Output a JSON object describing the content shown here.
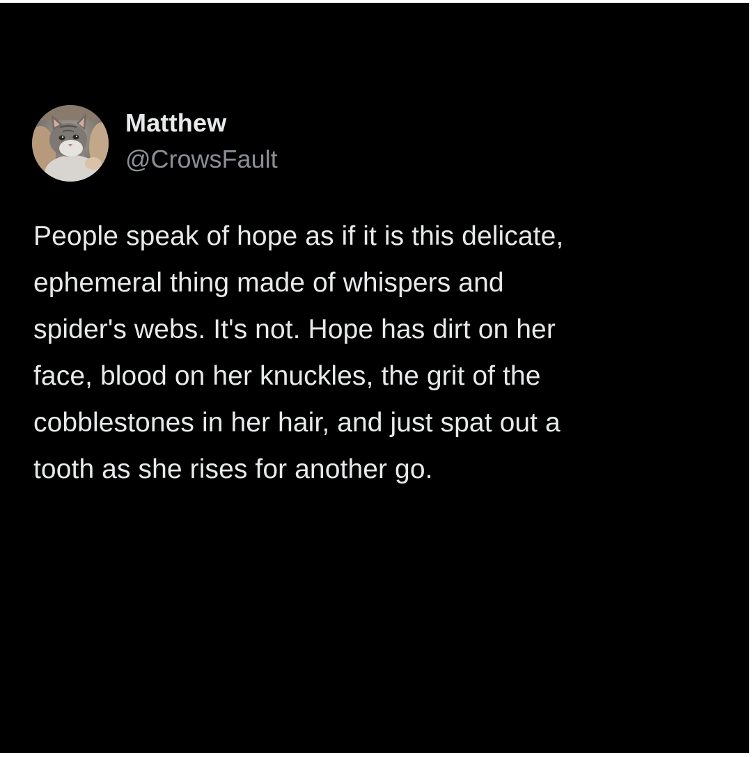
{
  "post": {
    "author": {
      "display_name": "Matthew",
      "handle": "@CrowsFault",
      "avatar_icon": "cat-avatar"
    },
    "body_lines": [
      "People speak of hope as if it is this delicate,",
      "ephemeral thing made of whispers and",
      "spider's webs. It's not. Hope has dirt on her",
      "face, blood on her knuckles, the grit of the",
      "cobblestones in her hair, and just spat out a",
      "tooth as she rises for another go."
    ]
  },
  "colors": {
    "background": "#000000",
    "primary_text": "#e7e9ea",
    "secondary_text": "#8b8f94"
  }
}
